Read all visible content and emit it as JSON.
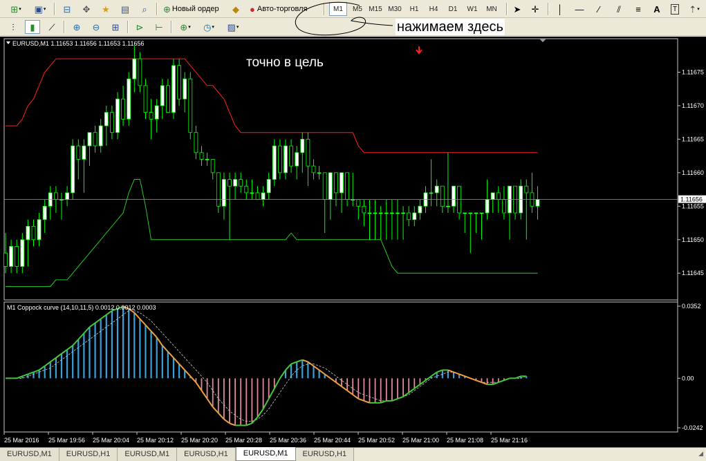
{
  "toolbar1": {
    "new_order_label": "Новый ордер",
    "auto_trading_label": "Авто-торговля",
    "timeframes": [
      "M1",
      "M5",
      "M15",
      "M30",
      "H1",
      "H4",
      "D1",
      "W1",
      "MN"
    ],
    "active_timeframe": "M1"
  },
  "annotation": {
    "click_here": "нажимаем здесь",
    "on_target": "точно в цель"
  },
  "main_chart": {
    "header": "EURUSD,M1  1.11653 1.11656 1.11653 1.11656",
    "current_price_label": "1.11656",
    "current_price": 1.11656
  },
  "indicator": {
    "header": "M1 Coppock curve  (14,10,11,5) 0.0012 0.0012 0.0003"
  },
  "chart_data": [
    {
      "type": "candlestick",
      "yticks": [
        "1.11675",
        "1.11670",
        "1.11665",
        "1.11660",
        "1.11655",
        "1.11650",
        "1.11645"
      ],
      "ylim": [
        1.11641,
        1.1168
      ],
      "price_line": 1.11656,
      "colors": {
        "bull": "#ffffff",
        "bear": "#000000",
        "wick": "#00ff00",
        "upper_band": "#ff2020",
        "lower_band": "#22cc22",
        "background": "#000000"
      },
      "candles": [
        [
          1.11648,
          1.11651,
          1.11645,
          1.11646
        ],
        [
          1.11646,
          1.1165,
          1.11645,
          1.11649
        ],
        [
          1.11649,
          1.1165,
          1.11645,
          1.11646
        ],
        [
          1.11646,
          1.11651,
          1.11645,
          1.1165
        ],
        [
          1.1165,
          1.11653,
          1.11646,
          1.11652
        ],
        [
          1.11652,
          1.11653,
          1.11649,
          1.1165
        ],
        [
          1.1165,
          1.11654,
          1.11649,
          1.11653
        ],
        [
          1.11653,
          1.11656,
          1.11651,
          1.11655
        ],
        [
          1.11655,
          1.11658,
          1.11653,
          1.11657
        ],
        [
          1.11657,
          1.11658,
          1.11654,
          1.11656
        ],
        [
          1.11656,
          1.11657,
          1.11653,
          1.11656
        ],
        [
          1.11656,
          1.11658,
          1.11655,
          1.11657
        ],
        [
          1.11657,
          1.11665,
          1.11656,
          1.11664
        ],
        [
          1.11664,
          1.11665,
          1.11659,
          1.11662
        ],
        [
          1.11662,
          1.11665,
          1.11657,
          1.11664
        ],
        [
          1.11664,
          1.11666,
          1.11661,
          1.11666
        ],
        [
          1.11666,
          1.11667,
          1.11663,
          1.11664
        ],
        [
          1.11664,
          1.11668,
          1.11663,
          1.11667
        ],
        [
          1.11667,
          1.1167,
          1.11664,
          1.11669
        ],
        [
          1.11669,
          1.1167,
          1.11665,
          1.11666
        ],
        [
          1.11666,
          1.11672,
          1.11665,
          1.11671
        ],
        [
          1.11671,
          1.11673,
          1.11667,
          1.11668
        ],
        [
          1.11668,
          1.11675,
          1.11667,
          1.11674
        ],
        [
          1.11674,
          1.11679,
          1.11672,
          1.11677
        ],
        [
          1.11677,
          1.11678,
          1.11672,
          1.11673
        ],
        [
          1.11673,
          1.11674,
          1.11668,
          1.11669
        ],
        [
          1.11669,
          1.11671,
          1.11665,
          1.11668
        ],
        [
          1.11668,
          1.11671,
          1.11666,
          1.1167
        ],
        [
          1.1167,
          1.11674,
          1.11668,
          1.11673
        ],
        [
          1.11673,
          1.11674,
          1.11669,
          1.11669
        ],
        [
          1.11669,
          1.11677,
          1.11668,
          1.11676
        ],
        [
          1.11676,
          1.11677,
          1.1167,
          1.11671
        ],
        [
          1.11671,
          1.11675,
          1.11669,
          1.11674
        ],
        [
          1.11674,
          1.11675,
          1.11665,
          1.11666
        ],
        [
          1.11666,
          1.11667,
          1.11662,
          1.11663
        ],
        [
          1.11663,
          1.11664,
          1.11661,
          1.11662
        ],
        [
          1.11662,
          1.11663,
          1.11661,
          1.11662
        ],
        [
          1.11662,
          1.11662,
          1.11659,
          1.1166
        ],
        [
          1.1166,
          1.1166,
          1.11654,
          1.11655
        ],
        [
          1.11655,
          1.1166,
          1.11653,
          1.11659
        ],
        [
          1.11659,
          1.1166,
          1.1165,
          1.11658
        ],
        [
          1.11658,
          1.1166,
          1.11656,
          1.11659
        ],
        [
          1.11659,
          1.1166,
          1.11657,
          1.11658
        ],
        [
          1.11658,
          1.11659,
          1.11656,
          1.11657
        ],
        [
          1.11657,
          1.11659,
          1.11656,
          1.11657
        ],
        [
          1.11657,
          1.11658,
          1.11656,
          1.11656
        ],
        [
          1.11656,
          1.11658,
          1.11655,
          1.11657
        ],
        [
          1.11657,
          1.1166,
          1.11656,
          1.11659
        ],
        [
          1.11659,
          1.11665,
          1.11658,
          1.11664
        ],
        [
          1.11664,
          1.11665,
          1.11659,
          1.1166
        ],
        [
          1.1166,
          1.11665,
          1.11659,
          1.11664
        ],
        [
          1.11664,
          1.11665,
          1.1166,
          1.11661
        ],
        [
          1.11661,
          1.11664,
          1.11659,
          1.11663
        ],
        [
          1.11663,
          1.11666,
          1.1166,
          1.11665
        ],
        [
          1.11665,
          1.11666,
          1.11658,
          1.11661
        ],
        [
          1.11661,
          1.11662,
          1.11659,
          1.1166
        ],
        [
          1.1166,
          1.11661,
          1.11659,
          1.1166
        ],
        [
          1.1166,
          1.1166,
          1.11651,
          1.11656
        ],
        [
          1.11656,
          1.1166,
          1.11653,
          1.1166
        ],
        [
          1.1166,
          1.1166,
          1.11655,
          1.11657
        ],
        [
          1.11657,
          1.1166,
          1.11654,
          1.1166
        ],
        [
          1.1166,
          1.1166,
          1.11655,
          1.11656
        ],
        [
          1.11656,
          1.1166,
          1.11655,
          1.11656
        ],
        [
          1.11656,
          1.11656,
          1.11653,
          1.11655
        ],
        [
          1.11655,
          1.11656,
          1.11652,
          1.11654
        ],
        [
          1.11654,
          1.11656,
          1.1165,
          1.11654
        ],
        [
          1.11654,
          1.11656,
          1.1165,
          1.11654
        ],
        [
          1.11654,
          1.11655,
          1.1165,
          1.11654
        ],
        [
          1.11654,
          1.11656,
          1.1165,
          1.11654
        ],
        [
          1.11654,
          1.11656,
          1.1165,
          1.11654
        ],
        [
          1.11654,
          1.11656,
          1.1165,
          1.11654
        ],
        [
          1.11654,
          1.11655,
          1.1165,
          1.11654
        ],
        [
          1.11654,
          1.11655,
          1.11652,
          1.11653
        ],
        [
          1.11653,
          1.11655,
          1.11652,
          1.11654
        ],
        [
          1.11654,
          1.11656,
          1.11653,
          1.11655
        ],
        [
          1.11655,
          1.11658,
          1.11654,
          1.11657
        ],
        [
          1.11657,
          1.11662,
          1.11655,
          1.11657
        ],
        [
          1.11657,
          1.11659,
          1.11655,
          1.11658
        ],
        [
          1.11658,
          1.11658,
          1.11654,
          1.11655
        ],
        [
          1.11655,
          1.11663,
          1.11654,
          1.11655
        ],
        [
          1.11655,
          1.11658,
          1.11654,
          1.11658
        ],
        [
          1.11658,
          1.11658,
          1.11653,
          1.11654
        ],
        [
          1.11654,
          1.11654,
          1.11651,
          1.11654
        ],
        [
          1.11654,
          1.11654,
          1.11648,
          1.11654
        ],
        [
          1.11654,
          1.11654,
          1.11651,
          1.11654
        ],
        [
          1.11654,
          1.11654,
          1.1165,
          1.11654
        ],
        [
          1.11654,
          1.11659,
          1.11653,
          1.11656
        ],
        [
          1.11656,
          1.11657,
          1.11654,
          1.11657
        ],
        [
          1.11657,
          1.11658,
          1.11654,
          1.11656
        ],
        [
          1.11656,
          1.11658,
          1.11653,
          1.11654
        ],
        [
          1.11654,
          1.11658,
          1.1165,
          1.11658
        ],
        [
          1.11658,
          1.11658,
          1.11653,
          1.11654
        ],
        [
          1.11654,
          1.11659,
          1.11653,
          1.11658
        ],
        [
          1.11658,
          1.11659,
          1.1165,
          1.11657
        ],
        [
          1.11657,
          1.1166,
          1.11654,
          1.11655
        ],
        [
          1.11655,
          1.11658,
          1.11653,
          1.11656
        ]
      ],
      "upper_band": [
        1.11667,
        1.11667,
        1.11667,
        1.11668,
        1.1167,
        1.11671,
        1.11673,
        1.11675,
        1.11676,
        1.11677,
        1.11677,
        1.11677,
        1.11677,
        1.11677,
        1.11677,
        1.11677,
        1.11677,
        1.11677,
        1.11677,
        1.11677,
        1.11677,
        1.11677,
        1.11677,
        1.11677,
        1.11677,
        1.11677,
        1.11677,
        1.11677,
        1.11677,
        1.11677,
        1.11677,
        1.11677,
        1.11677,
        1.11676,
        1.11675,
        1.11674,
        1.11673,
        1.11673,
        1.11672,
        1.11671,
        1.11669,
        1.11667,
        1.11666,
        1.11666,
        1.11666,
        1.11666,
        1.11666,
        1.11666,
        1.11666,
        1.11666,
        1.11666,
        1.11666,
        1.11666,
        1.11666,
        1.11666,
        1.11666,
        1.11666,
        1.11666,
        1.11666,
        1.11666,
        1.11666,
        1.11666,
        1.11666,
        1.11664,
        1.11663,
        1.11663,
        1.11663,
        1.11663,
        1.11663,
        1.11663,
        1.11663,
        1.11663,
        1.11663,
        1.11663,
        1.11663,
        1.11663,
        1.11663,
        1.11663,
        1.11663,
        1.11663,
        1.11663,
        1.11663,
        1.11663,
        1.11663,
        1.11663,
        1.11663,
        1.11663,
        1.11663,
        1.11663,
        1.11663,
        1.11663,
        1.11663,
        1.11663,
        1.11663,
        1.11663,
        1.11663
      ],
      "lower_band": [
        1.11643,
        1.11643,
        1.11643,
        1.11643,
        1.11643,
        1.11643,
        1.11643,
        1.11643,
        1.11643,
        1.11644,
        1.11644,
        1.11644,
        1.11645,
        1.11646,
        1.11647,
        1.11648,
        1.11649,
        1.1165,
        1.11651,
        1.11652,
        1.11653,
        1.11654,
        1.11657,
        1.11659,
        1.11659,
        1.11655,
        1.1165,
        1.1165,
        1.1165,
        1.1165,
        1.1165,
        1.1165,
        1.1165,
        1.1165,
        1.1165,
        1.1165,
        1.1165,
        1.1165,
        1.1165,
        1.1165,
        1.1165,
        1.1165,
        1.1165,
        1.1165,
        1.1165,
        1.1165,
        1.1165,
        1.1165,
        1.1165,
        1.1165,
        1.1165,
        1.11651,
        1.1165,
        1.1165,
        1.1165,
        1.1165,
        1.1165,
        1.1165,
        1.1165,
        1.1165,
        1.1165,
        1.1165,
        1.1165,
        1.1165,
        1.1165,
        1.1165,
        1.1165,
        1.1165,
        1.11648,
        1.11646,
        1.11645,
        1.11645,
        1.11645,
        1.11645,
        1.11645,
        1.11645,
        1.11645,
        1.11645,
        1.11645,
        1.11645,
        1.11645,
        1.11645,
        1.11645,
        1.11645,
        1.11645,
        1.11645,
        1.11645,
        1.11645,
        1.11645,
        1.11645,
        1.11645,
        1.11645,
        1.11645,
        1.11645,
        1.11645,
        1.11645
      ]
    },
    {
      "type": "line",
      "yticks": [
        "0.0352",
        "0.00",
        "-0.0242"
      ],
      "ylim": [
        -0.0242,
        0.0352
      ],
      "colors": {
        "hist_pos": "#3aa0dc",
        "hist_neg": "#e08a9a",
        "curve_up": "#44c83c",
        "curve_down": "#f0a040",
        "signal": "#cccccc"
      },
      "curve": [
        0.0,
        0.0,
        0.0,
        0.001,
        0.002,
        0.003,
        0.004,
        0.006,
        0.008,
        0.01,
        0.012,
        0.014,
        0.016,
        0.019,
        0.022,
        0.025,
        0.027,
        0.029,
        0.031,
        0.033,
        0.034,
        0.035,
        0.034,
        0.032,
        0.029,
        0.026,
        0.023,
        0.02,
        0.016,
        0.013,
        0.01,
        0.007,
        0.004,
        0.001,
        -0.002,
        -0.006,
        -0.01,
        -0.014,
        -0.017,
        -0.02,
        -0.022,
        -0.023,
        -0.023,
        -0.023,
        -0.022,
        -0.019,
        -0.015,
        -0.01,
        -0.005,
        0.0,
        0.004,
        0.007,
        0.008,
        0.009,
        0.008,
        0.006,
        0.004,
        0.002,
        0.0,
        -0.002,
        -0.004,
        -0.006,
        -0.008,
        -0.01,
        -0.011,
        -0.012,
        -0.012,
        -0.012,
        -0.011,
        -0.011,
        -0.01,
        -0.009,
        -0.007,
        -0.005,
        -0.003,
        -0.001,
        0.001,
        0.003,
        0.004,
        0.004,
        0.003,
        0.002,
        0.001,
        0.0,
        -0.001,
        -0.002,
        -0.003,
        -0.003,
        -0.002,
        -0.001,
        0.0,
        0.0,
        0.001,
        0.001
      ],
      "signal": [
        0.0,
        0.0,
        0.0,
        0.0,
        0.001,
        0.002,
        0.003,
        0.004,
        0.005,
        0.007,
        0.009,
        0.011,
        0.013,
        0.015,
        0.017,
        0.019,
        0.021,
        0.023,
        0.025,
        0.027,
        0.029,
        0.031,
        0.033,
        0.033,
        0.032,
        0.03,
        0.028,
        0.025,
        0.022,
        0.019,
        0.016,
        0.013,
        0.01,
        0.007,
        0.004,
        0.001,
        -0.002,
        -0.006,
        -0.01,
        -0.013,
        -0.016,
        -0.018,
        -0.02,
        -0.021,
        -0.021,
        -0.02,
        -0.018,
        -0.015,
        -0.011,
        -0.007,
        -0.003,
        0.001,
        0.004,
        0.006,
        0.007,
        0.007,
        0.006,
        0.005,
        0.003,
        0.001,
        -0.001,
        -0.003,
        -0.005,
        -0.007,
        -0.008,
        -0.009,
        -0.01,
        -0.011,
        -0.011,
        -0.011,
        -0.01,
        -0.009,
        -0.008,
        -0.006,
        -0.004,
        -0.002,
        0.0,
        0.001,
        0.002,
        0.003,
        0.003,
        0.002,
        0.001,
        0.0,
        -0.001,
        -0.002,
        -0.002,
        -0.002,
        -0.002,
        -0.001,
        0.0,
        0.0,
        0.0,
        0.001
      ]
    }
  ],
  "time_axis": [
    "25 Mar 2016",
    "25 Mar 19:56",
    "25 Mar 20:04",
    "25 Mar 20:12",
    "25 Mar 20:20",
    "25 Mar 20:28",
    "25 Mar 20:36",
    "25 Mar 20:44",
    "25 Mar 20:52",
    "25 Mar 21:00",
    "25 Mar 21:08",
    "25 Mar 21:16"
  ],
  "tabs": [
    {
      "label": "EURUSD,M1",
      "active": false
    },
    {
      "label": "EURUSD,H1",
      "active": false
    },
    {
      "label": "EURUSD,M1",
      "active": false
    },
    {
      "label": "EURUSD,H1",
      "active": false
    },
    {
      "label": "EURUSD,M1",
      "active": true
    },
    {
      "label": "EURUSD,H1",
      "active": false
    }
  ]
}
